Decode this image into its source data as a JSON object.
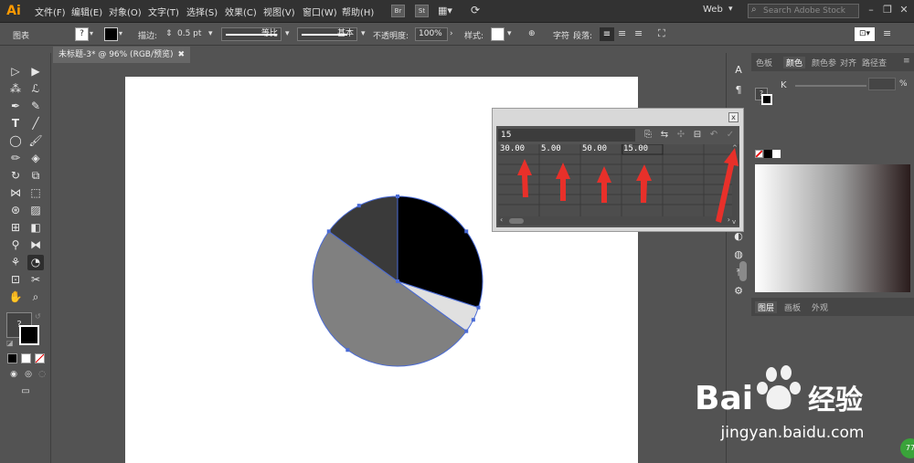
{
  "menubar": {
    "logo": "Ai",
    "items": [
      "文件(F)",
      "编辑(E)",
      "对象(O)",
      "文字(T)",
      "选择(S)",
      "效果(C)",
      "视图(V)",
      "窗口(W)",
      "帮助(H)"
    ],
    "bridge_btn": "Br",
    "stock_btn": "St",
    "workspace": "Web",
    "search_placeholder": "Search Adobe Stock"
  },
  "controlbar": {
    "object_label": "图表",
    "stroke_label": "描边:",
    "stroke_value": "0.5 pt",
    "uniform_label": "等比",
    "basic_label": "基本",
    "opacity_label": "不透明度:",
    "opacity_value": "100%",
    "style_label": "样式:",
    "char_label": "字符",
    "para_label": "段落:"
  },
  "document": {
    "tab_title": "未标题-3* @ 96% (RGB/预览)"
  },
  "graph_data": {
    "input_value": "15",
    "cells": [
      "30.00",
      "5.00",
      "50.00",
      "15.00"
    ]
  },
  "chart_data": {
    "type": "pie",
    "categories": [],
    "values": [
      30,
      5,
      50,
      15
    ],
    "colors": [
      "#000000",
      "#e0e0e0",
      "#808080",
      "#3a3a3a"
    ]
  },
  "right_panels": {
    "color_tabs": [
      "色板",
      "颜色",
      "颜色参",
      "对齐",
      "路径查"
    ],
    "k_label": "K",
    "k_unit": "%",
    "layer_tabs": [
      "图层",
      "画板",
      "外观"
    ]
  },
  "watermark": {
    "brand": "Bai",
    "brand_suffix": "经验",
    "url": "jingyan.baidu.com"
  },
  "colors": {
    "arrow_red": "#e8302a",
    "selection_blue": "#4a6bd6"
  }
}
